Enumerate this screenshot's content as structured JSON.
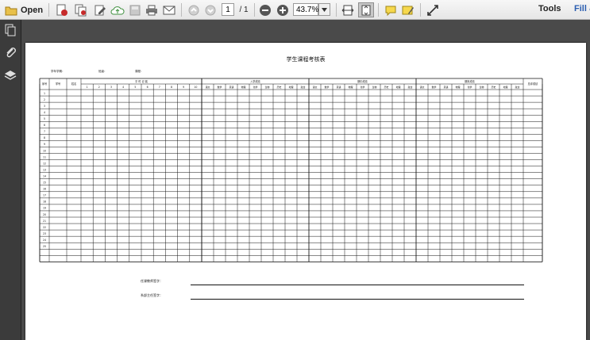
{
  "toolbar": {
    "open_label": "Open",
    "page_current": "1",
    "page_total": "/ 1",
    "zoom": "43.7%",
    "tools_label": "Tools",
    "fill_label": "Fill &"
  },
  "document": {
    "title": "学生课程考核表",
    "meta": [
      "学年学期：",
      "班级：",
      "课程："
    ],
    "table": {
      "col_index": "序号",
      "col_id": "学号",
      "col_name": "姓名",
      "group_daily": "平 时 记 载",
      "daily_cols": [
        "1",
        "2",
        "3",
        "4",
        "5",
        "6",
        "7",
        "8",
        "9",
        "10"
      ],
      "group_a": "入学成绩",
      "group_b": "期中成绩",
      "group_c": "期末成绩",
      "subjects": [
        "语文",
        "数学",
        "英语",
        "物理",
        "化学",
        "生物",
        "历史",
        "地理",
        "政治"
      ],
      "col_total": "总评成绩",
      "row_numbers": [
        "1",
        "2",
        "3",
        "4",
        "5",
        "6",
        "7",
        "8",
        "9",
        "10",
        "11",
        "12",
        "13",
        "14",
        "15",
        "16",
        "17",
        "18",
        "19",
        "20",
        "21",
        "22",
        "23",
        "24",
        "25"
      ]
    },
    "sig_teacher": "任课教师签字：",
    "sig_director": "系部主任签字："
  }
}
